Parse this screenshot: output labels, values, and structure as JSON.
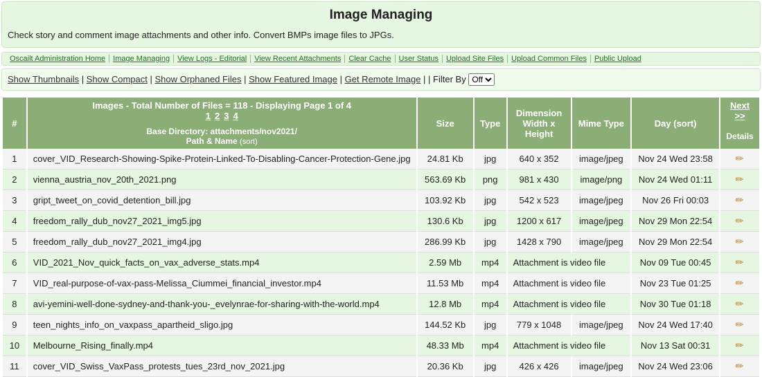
{
  "header": {
    "title": "Image Managing",
    "desc": "Check story and comment image attachments and other info. Convert BMPs image files to JPGs."
  },
  "nav": [
    "Oscailt Administration Home",
    "Image Managing",
    "View Logs - Editorial",
    "View Recent Attachments",
    "Clear Cache",
    "User Status",
    "Upload Site Files",
    "Upload Common Files",
    "Public Upload"
  ],
  "filter": {
    "links": [
      "Show Thumbnails",
      "Show Compact",
      "Show Orphaned Files",
      "Show Featured Image",
      "Get Remote Image"
    ],
    "label": "Filter By",
    "selected": "Off"
  },
  "table": {
    "summary": "Images - Total Number of Files = 118  - Displaying Page 1 of 4",
    "pages": [
      "1",
      "2",
      "3",
      "4"
    ],
    "next": "Next >>",
    "base_dir_label": "Base Directory: attachments/nov2021/",
    "path_name_label": "Path & Name",
    "sort_label": "(sort)",
    "cols": {
      "num": "#",
      "size": "Size",
      "type": "Type",
      "dim": "Dimension",
      "dim2": "Width x Height",
      "mime": "Mime Type",
      "day": "Day",
      "details": "Details"
    }
  },
  "rows": [
    {
      "n": "1",
      "name": "cover_VID_Research-Showing-Spike-Protein-Linked-To-Disabling-Cancer-Protection-Gene.jpg",
      "size": "24.81 Kb",
      "type": "jpg",
      "dim": "640 x 352",
      "mime": "image/jpeg",
      "day": "Nov 24 Wed 23:58",
      "video": false
    },
    {
      "n": "2",
      "name": "vienna_austria_nov_20th_2021.png",
      "size": "563.69 Kb",
      "type": "png",
      "dim": "981 x 430",
      "mime": "image/png",
      "day": "Nov 24 Wed 01:11",
      "video": false
    },
    {
      "n": "3",
      "name": "gript_tweet_on_covid_detention_bill.jpg",
      "size": "103.92 Kb",
      "type": "jpg",
      "dim": "542 x 523",
      "mime": "image/jpeg",
      "day": "Nov 26 Fri 00:03",
      "video": false
    },
    {
      "n": "4",
      "name": "freedom_rally_dub_nov27_2021_img5.jpg",
      "size": "130.6 Kb",
      "type": "jpg",
      "dim": "1200 x 617",
      "mime": "image/jpeg",
      "day": "Nov 29 Mon 22:54",
      "video": false
    },
    {
      "n": "5",
      "name": "freedom_rally_dub_nov27_2021_img4.jpg",
      "size": "286.99 Kb",
      "type": "jpg",
      "dim": "1428 x 790",
      "mime": "image/jpeg",
      "day": "Nov 29 Mon 22:54",
      "video": false
    },
    {
      "n": "6",
      "name": "VID_2021_Nov_quick_facts_on_vax_adverse_stats.mp4",
      "size": "2.59 Mb",
      "type": "mp4",
      "dim": "",
      "mime": "",
      "day": "Nov 09 Tue 00:45",
      "video": true
    },
    {
      "n": "7",
      "name": "VID_real-purpose-of-vax-pass-Melissa_Ciummei_financial_investor.mp4",
      "size": "11.53 Mb",
      "type": "mp4",
      "dim": "",
      "mime": "",
      "day": "Nov 23 Tue 01:25",
      "video": true
    },
    {
      "n": "8",
      "name": "avi-yemini-well-done-sydney-and-thank-you-_evelynrae-for-sharing-with-the-world.mp4",
      "size": "12.8 Mb",
      "type": "mp4",
      "dim": "",
      "mime": "",
      "day": "Nov 30 Tue 01:18",
      "video": true
    },
    {
      "n": "9",
      "name": "teen_nights_info_on_vaxpass_apartheid_sligo.jpg",
      "size": "144.52 Kb",
      "type": "jpg",
      "dim": "779 x 1048",
      "mime": "image/jpeg",
      "day": "Nov 24 Wed 17:40",
      "video": false
    },
    {
      "n": "10",
      "name": "Melbourne_Rising_finally.mp4",
      "size": "48.33 Mb",
      "type": "mp4",
      "dim": "",
      "mime": "",
      "day": "Nov 13 Sat 00:31",
      "video": true
    },
    {
      "n": "11",
      "name": "cover_VID_Swiss_VaxPass_protests_tues_23rd_nov_2021.jpg",
      "size": "20.36 Kb",
      "type": "jpg",
      "dim": "426 x 426",
      "mime": "image/jpeg",
      "day": "Nov 24 Wed 23:06",
      "video": false
    }
  ],
  "video_text": "Attachment is video file"
}
